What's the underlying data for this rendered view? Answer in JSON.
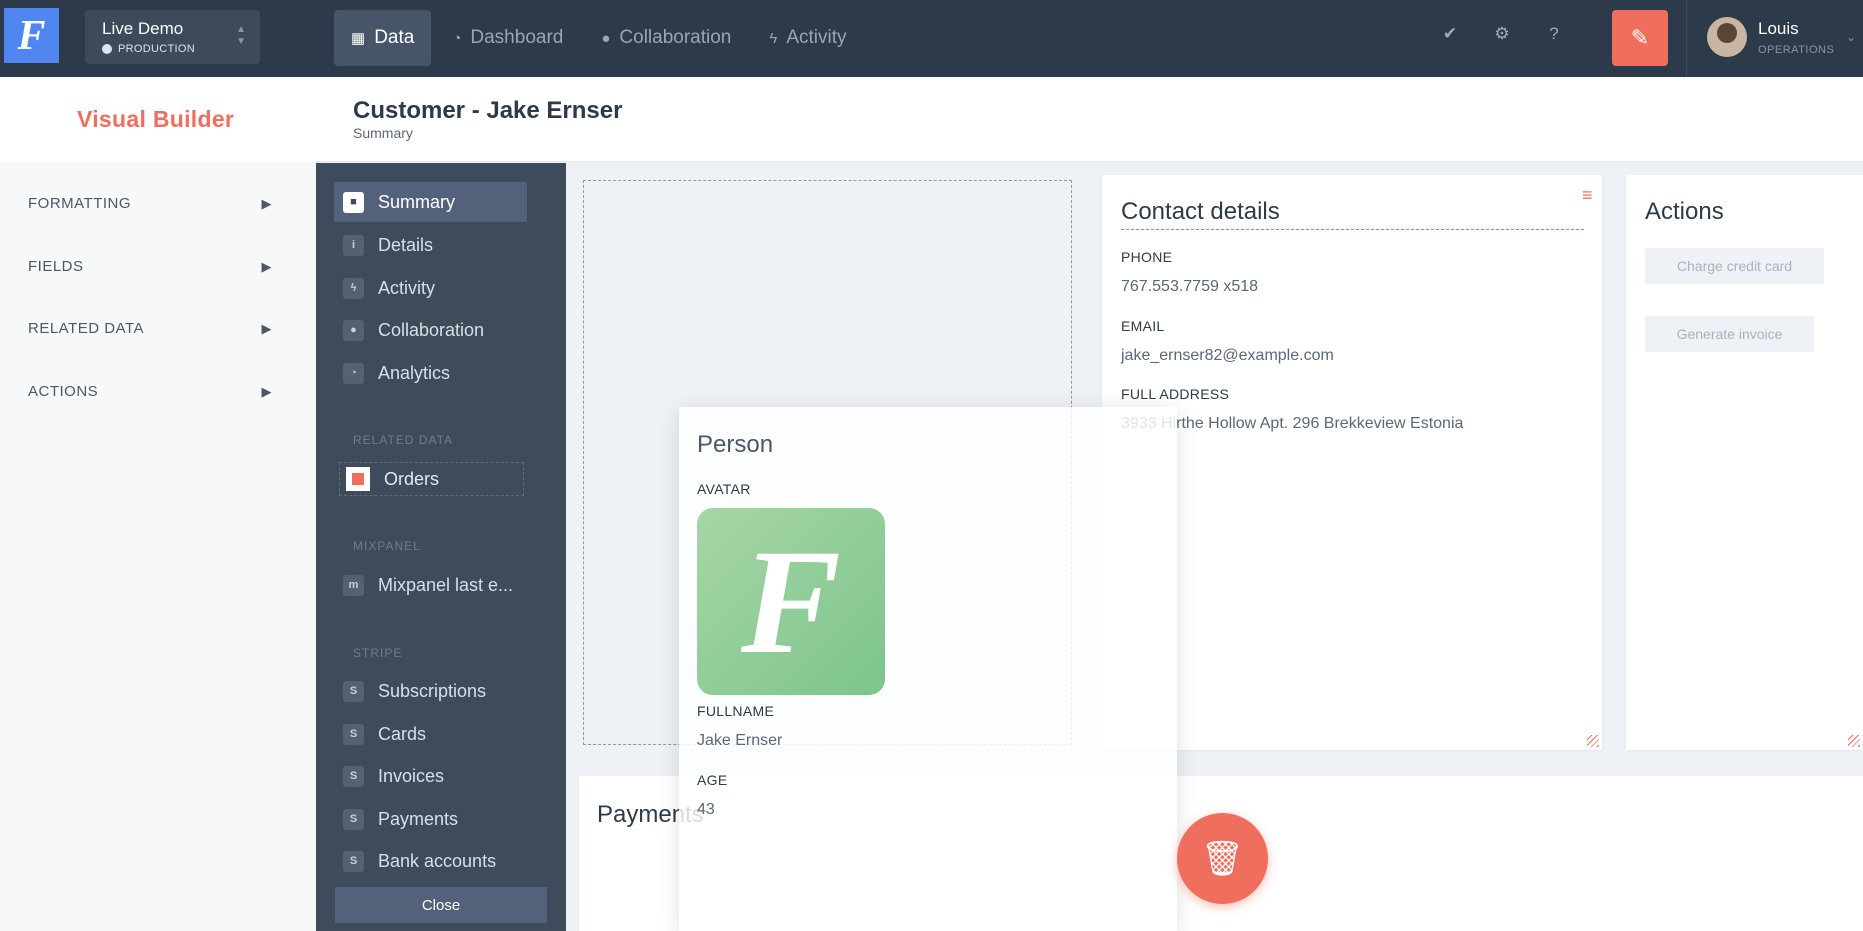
{
  "app": {
    "logo_letter": "F",
    "accent_color": "#f06e5e",
    "topbar_color": "#2d3a49"
  },
  "project": {
    "name": "Live Demo",
    "environment": "PRODUCTION"
  },
  "nav": [
    {
      "label": "Data",
      "icon": "table-icon",
      "active": true
    },
    {
      "label": "Dashboard",
      "icon": "dashboard-icon"
    },
    {
      "label": "Collaboration",
      "icon": "comments-icon"
    },
    {
      "label": "Activity",
      "icon": "bolt-icon"
    }
  ],
  "top_icons": [
    "check-icon",
    "gear-icon",
    "help-icon"
  ],
  "user": {
    "name": "Louis",
    "role": "OPERATIONS"
  },
  "builder": {
    "title": "Visual Builder",
    "items": [
      "FORMATTING",
      "FIELDS",
      "RELATED DATA",
      "ACTIONS"
    ]
  },
  "page": {
    "title": "Customer - Jake Ernser",
    "subtitle": "Summary"
  },
  "record_nav": {
    "main": [
      {
        "label": "Summary",
        "icon": "summary-icon",
        "active": true
      },
      {
        "label": "Details",
        "icon": "info-icon"
      },
      {
        "label": "Activity",
        "icon": "bolt-icon"
      },
      {
        "label": "Collaboration",
        "icon": "comments-icon"
      },
      {
        "label": "Analytics",
        "icon": "dashboard-icon"
      }
    ],
    "related_title": "RELATED DATA",
    "orders_label": "Orders",
    "mixpanel_title": "MIXPANEL",
    "mixpanel_item": "Mixpanel last e...",
    "stripe_title": "STRIPE",
    "stripe_items": [
      "Subscriptions",
      "Cards",
      "Invoices",
      "Payments",
      "Bank accounts"
    ],
    "close_label": "Close"
  },
  "contact": {
    "title": "Contact details",
    "fields": [
      {
        "label": "PHONE",
        "value": "767.553.7759 x518"
      },
      {
        "label": "EMAIL",
        "value": "jake_ernser82@example.com"
      },
      {
        "label": "FULL ADDRESS",
        "value": "3933 Hirthe Hollow Apt. 296 Brekkeview Estonia"
      }
    ]
  },
  "actions": {
    "title": "Actions",
    "buttons": [
      "Charge credit card",
      "Generate invoice"
    ]
  },
  "payments": {
    "title": "Payments"
  },
  "person": {
    "title": "Person",
    "avatar_label": "AVATAR",
    "avatar_letter": "F",
    "fullname_label": "FULLNAME",
    "fullname_value": "Jake Ernser",
    "age_label": "AGE",
    "age_value": "43"
  }
}
